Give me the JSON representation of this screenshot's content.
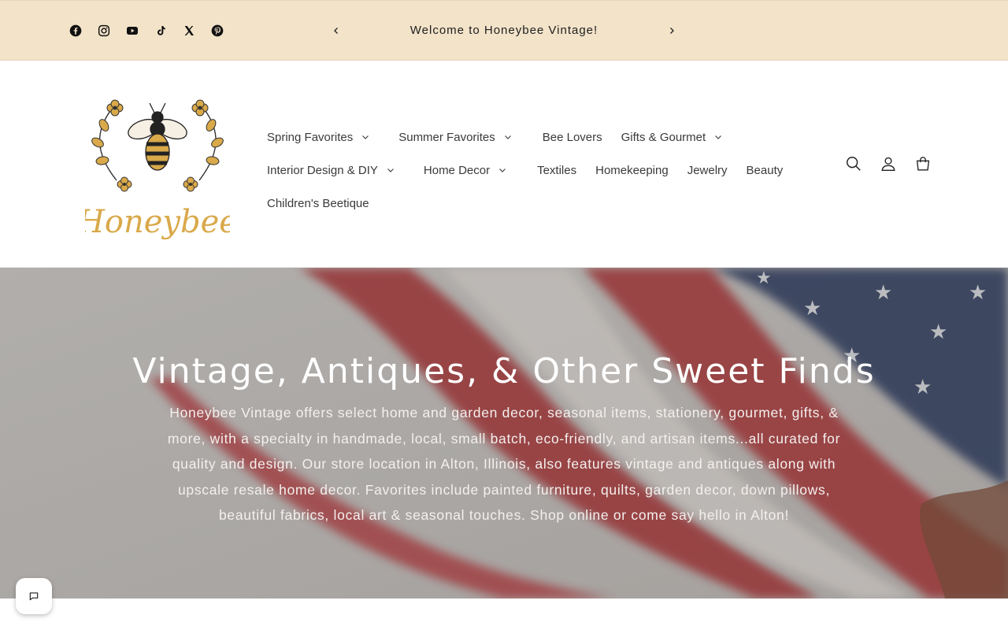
{
  "announcement": {
    "text": "Welcome to Honeybee Vintage!",
    "socials": [
      "facebook-icon",
      "instagram-icon",
      "youtube-icon",
      "tiktok-icon",
      "x-icon",
      "pinterest-icon"
    ]
  },
  "logo": {
    "text": "Honeybee"
  },
  "nav": {
    "row1": [
      {
        "label": "Spring Favorites",
        "dropdown": true
      },
      {
        "label": "Summer Favorites",
        "dropdown": true
      },
      {
        "label": "Bee Lovers",
        "dropdown": false
      },
      {
        "label": "Gifts & Gourmet",
        "dropdown": true
      }
    ],
    "row2": [
      {
        "label": "Interior Design & DIY",
        "dropdown": true
      },
      {
        "label": "Home Decor",
        "dropdown": true
      },
      {
        "label": "Textiles",
        "dropdown": false
      },
      {
        "label": "Homekeeping",
        "dropdown": false
      },
      {
        "label": "Jewelry",
        "dropdown": false
      },
      {
        "label": "Beauty",
        "dropdown": false
      }
    ],
    "row3": [
      {
        "label": "Children's Beetique",
        "dropdown": false
      }
    ]
  },
  "header_icons": [
    "search-icon",
    "account-icon",
    "cart-icon"
  ],
  "hero": {
    "title": "Vintage, Antiques, & Other Sweet Finds",
    "text": "Honeybee Vintage offers select home and garden decor, seasonal items, stationery, gourmet, gifts, & more, with a specialty in handmade, local, small batch, eco-friendly, and artisan items...all curated for quality and design. Our store location in Alton, Illinois, also features vintage and antiques along with upscale resale home decor. Favorites include painted furniture, quilts, garden decor, down pillows, beautiful fabrics, local art & seasonal touches. Shop online or come say hello in Alton!"
  },
  "colors": {
    "announcement_bg": "#f2e3c9",
    "logo_gold": "#d9a94a",
    "text_dark": "#3a3a3a"
  }
}
